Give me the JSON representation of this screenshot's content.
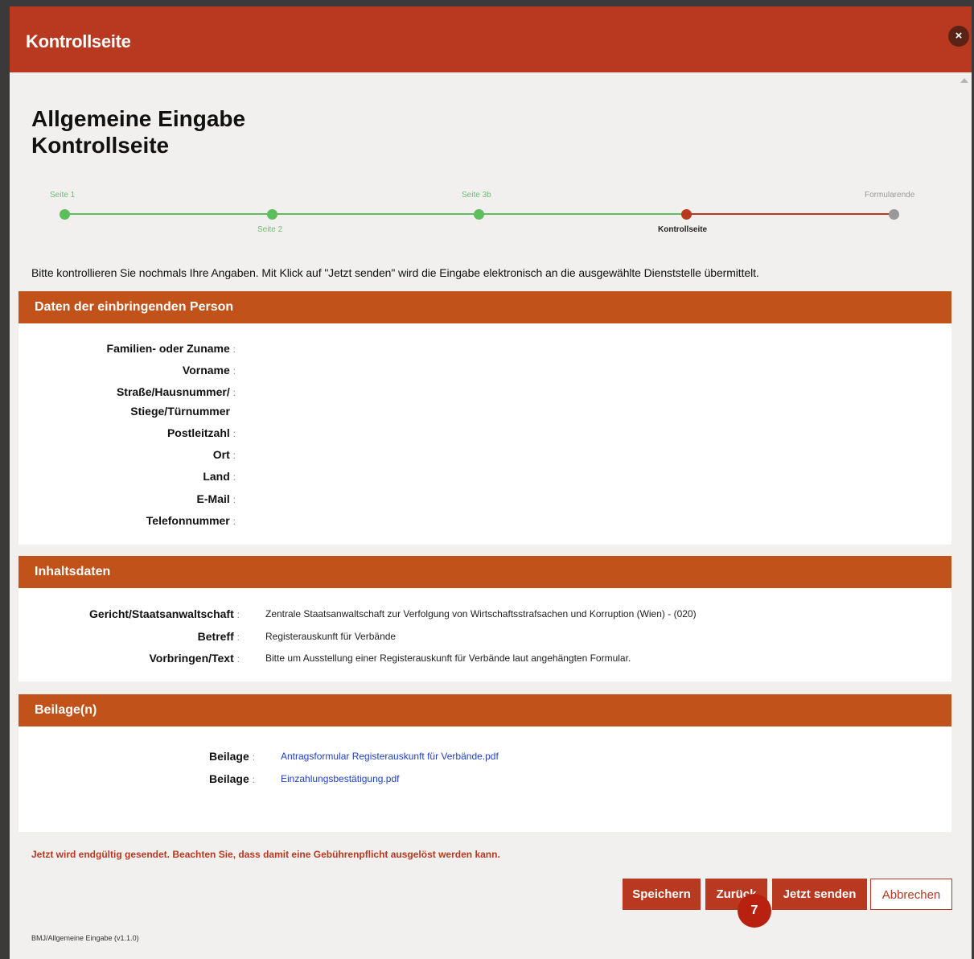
{
  "modal": {
    "title": "Kontrollseite",
    "close_label": "×"
  },
  "heading": {
    "line1": "Allgemeine Eingabe",
    "line2": "Kontrollseite"
  },
  "stepper": {
    "steps": [
      {
        "label": "Seite 1",
        "state": "done"
      },
      {
        "label": "Seite 2",
        "state": "done"
      },
      {
        "label": "Seite 3b",
        "state": "done"
      },
      {
        "label": "Kontrollseite",
        "state": "current"
      },
      {
        "label": "Formularende",
        "state": "pending"
      }
    ]
  },
  "intro_text": "Bitte kontrollieren Sie nochmals Ihre Angaben. Mit Klick auf \"Jetzt senden\" wird die Eingabe elektronisch an die ausgewählte Dienststelle übermittelt.",
  "person": {
    "title": "Daten der einbringenden Person",
    "fields": [
      {
        "label": "Familien- oder Zuname",
        "value": ""
      },
      {
        "label": "Vorname",
        "value": ""
      },
      {
        "label": "Straße/Hausnummer/",
        "label2": "Stiege/Türnummer",
        "value": ""
      },
      {
        "label": "Postleitzahl",
        "value": ""
      },
      {
        "label": "Ort",
        "value": ""
      },
      {
        "label": "Land",
        "value": ""
      },
      {
        "label": "E-Mail",
        "value": ""
      },
      {
        "label": "Telefonnummer",
        "value": ""
      }
    ]
  },
  "content": {
    "title": "Inhaltsdaten",
    "fields": [
      {
        "label": "Gericht/Staatsanwaltschaft",
        "value": "Zentrale Staatsanwaltschaft zur Verfolgung von Wirtschaftsstrafsachen und Korruption (Wien) - (020)"
      },
      {
        "label": "Betreff",
        "value": "Registerauskunft für Verbände"
      },
      {
        "label": "Vorbringen/Text",
        "value": "Bitte um Ausstellung einer Registerauskunft für Verbände laut angehängten Formular."
      }
    ]
  },
  "attachments": {
    "title": "Beilage(n)",
    "items": [
      {
        "label": "Beilage",
        "value": "Antragsformular Registerauskunft für Verbände.pdf"
      },
      {
        "label": "Beilage",
        "value": "Einzahlungsbestätigung.pdf"
      }
    ]
  },
  "colon": ":",
  "warning": "Jetzt wird endgültig gesendet. Beachten Sie, dass damit eine Gebührenpflicht ausgelöst werden kann.",
  "buttons": {
    "save": "Speichern",
    "back": "Zurück",
    "send": "Jetzt senden",
    "cancel": "Abbrechen"
  },
  "badge": "7",
  "version": "BMJ/Allgemeine Eingabe (v1.1.0)",
  "colors": {
    "header": "#b8391f",
    "section": "#c0521a",
    "done": "#5cbf5c",
    "current": "#b8391f",
    "pending": "#999999"
  }
}
